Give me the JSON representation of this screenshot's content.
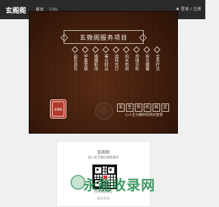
{
  "topbar": {
    "brand": "玄阁阁",
    "nav": [
      "首页",
      "归档"
    ],
    "right": "♠ 登录 / 注册"
  },
  "board": {
    "title": "玄微阁服务项目",
    "columns": [
      {
        "text": "起名改名"
      },
      {
        "text": "学業发展"
      },
      {
        "text": "婚姻职场"
      },
      {
        "text": "事业财运"
      },
      {
        "text": "选择吉日"
      },
      {
        "text": "风水布局"
      },
      {
        "text": "命理分析"
      },
      {
        "text": "和合健康"
      },
      {
        "text": "全息疗法"
      }
    ],
    "seal_text": "玄微阁",
    "motto_cells": [
      "玄",
      "生",
      "布",
      "机",
      "局",
      "定"
    ],
    "motto_line2": "心人生为聚的原则点智慧"
  },
  "contact_card": {
    "title": "玄阁阁",
    "subtitle": "加入玄学微信群组服务",
    "middle": "扫码添加微信",
    "bottom": "服务咨询"
  },
  "watermark": {
    "text": "永能收录网",
    "icon": "globe-icon"
  },
  "colors": {
    "topbar": "#2a2a2a",
    "board_wood_dark": "#2a1208",
    "board_wood_mid": "#5a2c16",
    "seal_red": "#b23a2a",
    "watermark_green": "#248c50"
  }
}
